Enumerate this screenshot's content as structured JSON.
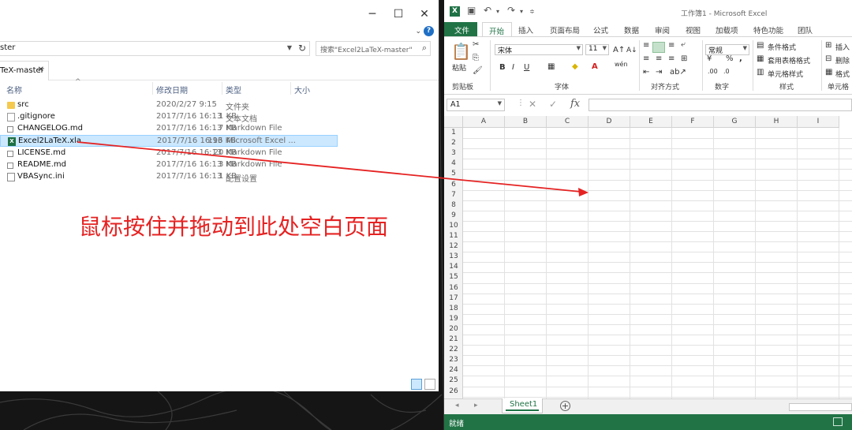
{
  "explorer": {
    "address_path": "ster",
    "search_placeholder": "搜索\"Excel2LaTeX-master\"",
    "tab_label": "TeX-master",
    "columns": {
      "name": "名称",
      "date": "修改日期",
      "type": "类型",
      "size": "大小"
    },
    "files": [
      {
        "name": "src",
        "date": "2020/2/27 9:15",
        "type": "文件夹",
        "size": "",
        "icon": "folder-icon",
        "selected": false
      },
      {
        "name": ".gitignore",
        "date": "2017/7/16 16:13",
        "type": "文本文档",
        "size": "1 KB",
        "icon": "text-file-icon",
        "selected": false
      },
      {
        "name": "CHANGELOG.md",
        "date": "2017/7/16 16:13",
        "type": "Markdown File",
        "size": "7 KB",
        "icon": "markdown-file-icon",
        "selected": false
      },
      {
        "name": "Excel2LaTeX.xla",
        "date": "2017/7/16 16:13",
        "type": "Microsoft Excel ...",
        "size": "196 KB",
        "icon": "excel-file-icon",
        "selected": true
      },
      {
        "name": "LICENSE.md",
        "date": "2017/7/16 16:13",
        "type": "Markdown File",
        "size": "20 KB",
        "icon": "markdown-file-icon",
        "selected": false
      },
      {
        "name": "README.md",
        "date": "2017/7/16 16:13",
        "type": "Markdown File",
        "size": "3 KB",
        "icon": "markdown-file-icon",
        "selected": false
      },
      {
        "name": "VBASync.ini",
        "date": "2017/7/16 16:13",
        "type": "配置设置",
        "size": "1 KB",
        "icon": "settings-file-icon",
        "selected": false
      }
    ]
  },
  "annotation": {
    "text": "鼠标按住并拖动到此处空白页面",
    "color": "#e52222"
  },
  "excel": {
    "window_title": "工作簿1 - Microsoft Excel",
    "ribbon_tabs": [
      "文件",
      "开始",
      "插入",
      "页面布局",
      "公式",
      "数据",
      "审阅",
      "视图",
      "加载项",
      "特色功能",
      "团队"
    ],
    "clipboard": {
      "paste": "粘贴",
      "group": "剪贴板"
    },
    "font": {
      "name": "宋体",
      "size": "11",
      "bold": "B",
      "italic": "I",
      "underline": "U",
      "group": "字体"
    },
    "alignment_group": "对齐方式",
    "number": {
      "format": "常规",
      "group": "数字"
    },
    "styles": {
      "conditional": "条件格式",
      "table": "套用表格格式",
      "cell": "单元格样式",
      "group": "样式"
    },
    "cells": {
      "insert": "插入",
      "delete": "删除",
      "format": "格式",
      "group": "单元格"
    },
    "name_box": "A1",
    "fx": "fx",
    "columns": [
      "A",
      "B",
      "C",
      "D",
      "E",
      "F",
      "G",
      "H",
      "I"
    ],
    "rows": [
      "1",
      "2",
      "3",
      "4",
      "5",
      "6",
      "7",
      "8",
      "9",
      "10",
      "11",
      "12",
      "13",
      "14",
      "15",
      "16",
      "17",
      "18",
      "19",
      "20",
      "21",
      "22",
      "23",
      "24",
      "25",
      "26"
    ],
    "sheet_tab": "Sheet1",
    "status": "就绪",
    "brand_color": "#217346"
  }
}
